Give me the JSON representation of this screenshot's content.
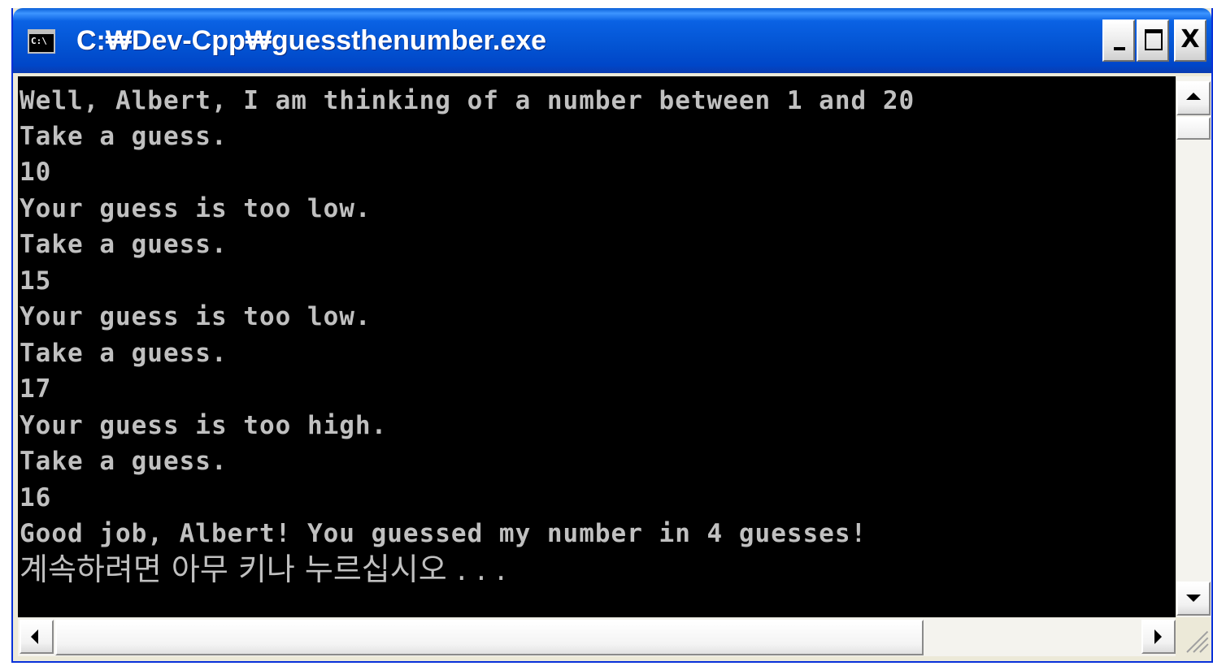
{
  "window": {
    "title": "C:₩Dev-Cpp₩guessthenumber.exe",
    "icon": "console-icon",
    "icon_text": "C:\\",
    "minimize_label": "",
    "maximize_label": "",
    "close_label": "X"
  },
  "console": {
    "lines": [
      "Well, Albert, I am thinking of a number between 1 and 20",
      "Take a guess.",
      "10",
      "Your guess is too low.",
      "Take a guess.",
      "15",
      "Your guess is too low.",
      "Take a guess.",
      "17",
      "Your guess is too high.",
      "Take a guess.",
      "16",
      "Good job, Albert! You guessed my number in 4 guesses!"
    ],
    "prompt": "계속하려면 아무 키나 누르십시오 . . ."
  },
  "colors": {
    "titlebar": "#0353D2",
    "console_bg": "#000000",
    "console_text": "#C0C0C0",
    "frame": "#ECE9D8"
  }
}
